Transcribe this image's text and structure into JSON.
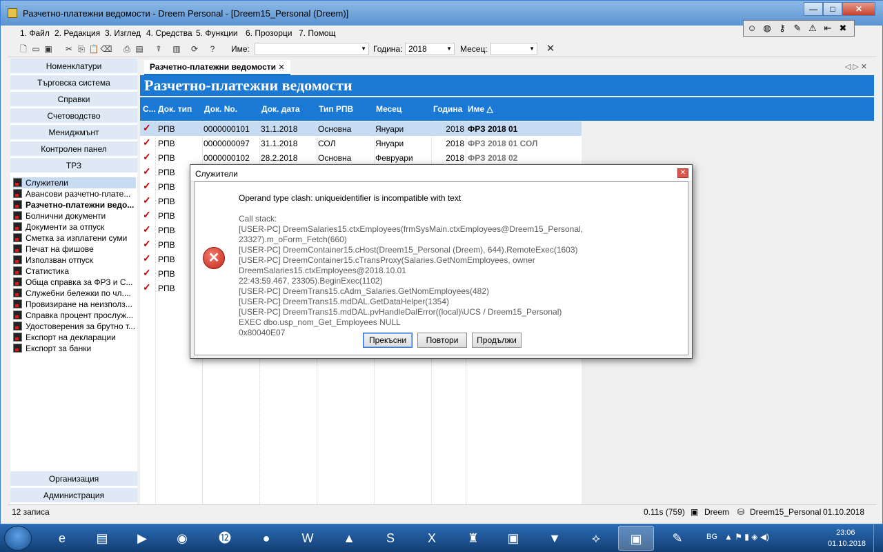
{
  "window": {
    "title": "Разчетно-платежни ведомости - Dreem Personal - [Dreem15_Personal (Dreem)]",
    "min": "—",
    "max": "□",
    "close": "✕"
  },
  "menu": [
    {
      "label": "1. Файл"
    },
    {
      "label": "2. Редакция"
    },
    {
      "label": "3. Изглед"
    },
    {
      "label": "4. Средства"
    },
    {
      "label": "5. Функции"
    },
    {
      "label": "6. Прозорци"
    },
    {
      "label": "7. Помощ"
    }
  ],
  "toolbar": {
    "name_label": "Име:",
    "name_value": "",
    "year_label": "Година:",
    "year_value": "2018",
    "month_label": "Месец:",
    "month_value": "",
    "clear": "✕"
  },
  "sidebar": {
    "top_buttons": [
      "Номенклатури",
      "Търговска система",
      "Справки",
      "Счетоводство",
      "Мениджмънт",
      "Контролен панел",
      "ТРЗ"
    ],
    "items": [
      "Служители",
      "Авансови разчетно-плате...",
      "Разчетно-платежни ведо...",
      "Болнични документи",
      "Документи за отпуск",
      "Сметка за изплатени суми",
      "Печат на фишове",
      "Използван отпуск",
      "Статистика",
      "Обща справка за ФРЗ и С...",
      "Служебни бележки по чл....",
      "Провизиране на неизполз...",
      "Справка процент прослуж...",
      "Удостоверения за брутно т...",
      "Експорт на декларации",
      "Експорт за банки"
    ],
    "bottom_buttons": [
      "Организация",
      "Администрация"
    ]
  },
  "tab": {
    "label": "Разчетно-платежни ведомости",
    "close": "✕",
    "nav": "◁ ▷ ✕"
  },
  "banner": "Разчетно-платежни ведомости",
  "table": {
    "headers": [
      "С...",
      "Док. тип",
      "Док. No.",
      "Док. дата",
      "Тип РПВ",
      "Месец",
      "Година",
      "Име △"
    ],
    "rows": [
      {
        "type": "РПВ",
        "no": "0000000101",
        "date": "31.1.2018",
        "kind": "Основна",
        "month": "Януари",
        "year": "2018",
        "name": "ФРЗ 2018 01"
      },
      {
        "type": "РПВ",
        "no": "0000000097",
        "date": "31.1.2018",
        "kind": "СОЛ",
        "month": "Януари",
        "year": "2018",
        "name": "ФРЗ 2018 01 СОЛ"
      },
      {
        "type": "РПВ",
        "no": "0000000102",
        "date": "28.2.2018",
        "kind": "Основна",
        "month": "Февруари",
        "year": "2018",
        "name": "ФРЗ 2018 02"
      },
      {
        "type": "РПВ"
      },
      {
        "type": "РПВ"
      },
      {
        "type": "РПВ"
      },
      {
        "type": "РПВ"
      },
      {
        "type": "РПВ"
      },
      {
        "type": "РПВ"
      },
      {
        "type": "РПВ"
      },
      {
        "type": "РПВ"
      },
      {
        "type": "РПВ"
      }
    ]
  },
  "status": {
    "count": "12 записа",
    "timing": "0.11s (759)",
    "user": "Dreem",
    "db": "Dreem15_Personal",
    "date": "01.10.2018"
  },
  "dialog": {
    "title": "Служители",
    "message": "Operand type clash: uniqueidentifier is incompatible with text",
    "stack": [
      "Call stack:",
      "[USER-PC] DreemSalaries15.ctxEmployees(frmSysMain.ctxEmployees@Dreem15_Personal, 23327).m_oForm_Fetch(660)",
      "[USER-PC] DreemContainer15.cHost(Dreem15_Personal (Dreem), 644).RemoteExec(1603)",
      "[USER-PC] DreemContainer15.cTransProxy(Salaries.GetNomEmployees, owner DreemSalaries15.ctxEmployees@2018.10.01\n22:43:59.467, 23305).BeginExec(1102)",
      "[USER-PC] DreemTrans15.cAdm_Salaries.GetNomEmployees(482)",
      "[USER-PC] DreemTrans15.mdDAL.GetDataHelper(1354)",
      "[USER-PC] DreemTrans15.mdDAL.pvHandleDalError((local)\\UCS / Dreem15_Personal)",
      "EXEC dbo.usp_nom_Get_Employees NULL",
      "0x80040E07"
    ],
    "buttons": {
      "abort": "Прекъсни",
      "retry": "Повтори",
      "continue": "Продължи"
    }
  },
  "taskbar": {
    "lang": "BG",
    "time": "23:06",
    "date": "01.10.2018"
  }
}
